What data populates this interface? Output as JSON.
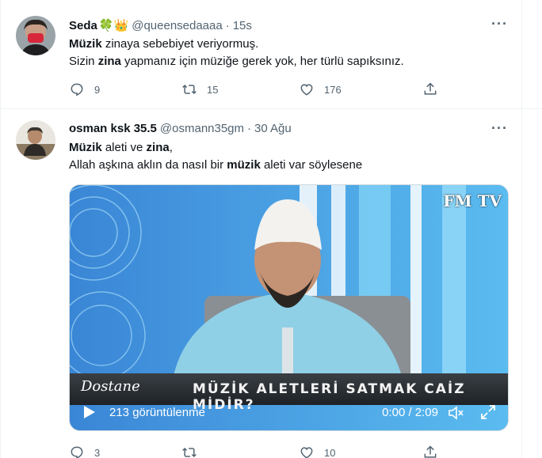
{
  "tweets": [
    {
      "name": "Seda",
      "emoji": "🍀👑",
      "handle": "@queensedaaaa",
      "dot": "·",
      "time": "15s",
      "lines": [
        [
          {
            "b": true,
            "t": "Müzik"
          },
          {
            "b": false,
            "t": " zinaya sebebiyet veriyormuş."
          }
        ],
        [
          {
            "b": false,
            "t": "Sizin "
          },
          {
            "b": true,
            "t": "zina"
          },
          {
            "b": false,
            "t": " yapmanız için müziğe gerek yok, her türlü sapıksınız."
          }
        ]
      ],
      "reply_count": "9",
      "retweet_count": "15",
      "like_count": "176",
      "more": "···"
    },
    {
      "name": "osman ksk 35.5",
      "handle": "@osmann35gm",
      "dot": "·",
      "time": "30 Ağu",
      "lines": [
        [
          {
            "b": true,
            "t": "Müzik"
          },
          {
            "b": false,
            "t": " aleti ve "
          },
          {
            "b": true,
            "t": "zina"
          },
          {
            "b": false,
            "t": ","
          }
        ],
        [
          {
            "b": false,
            "t": "Allah aşkına aklın da nasıl bir "
          },
          {
            "b": true,
            "t": "müzik"
          },
          {
            "b": false,
            "t": " aleti var söylesene"
          }
        ]
      ],
      "video": {
        "caption": "MÜZİK ALETLERİ SATMAK CAİZ MİDİR?",
        "show_logo": "Dostane",
        "channel_logo": "FM TV",
        "views": "213 görüntülenme",
        "timecode": "0:00 / 2:09"
      },
      "reply_count": "3",
      "retweet_count": "",
      "like_count": "10",
      "more": "···"
    }
  ],
  "colors": {
    "text": "#0f1419",
    "muted": "#536471",
    "border": "#eff3f4"
  },
  "icons": [
    "reply-icon",
    "retweet-icon",
    "like-icon",
    "share-icon",
    "more-icon",
    "play-icon",
    "volume-icon",
    "fullscreen-icon"
  ]
}
